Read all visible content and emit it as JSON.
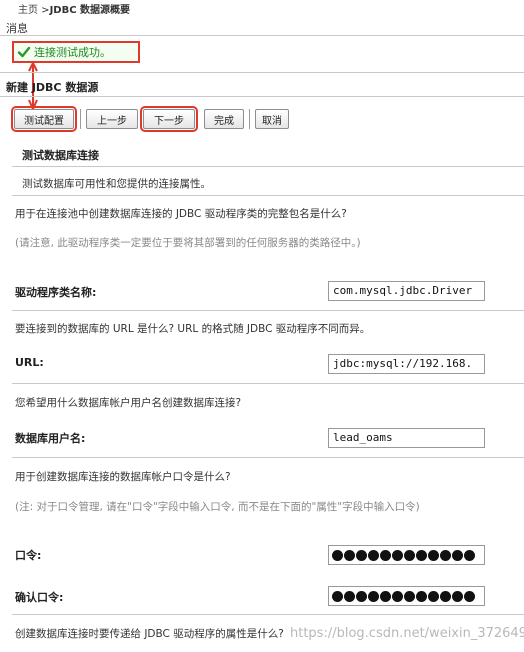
{
  "breadcrumb": {
    "home": "主页",
    "separator": " >",
    "current": "JDBC 数据源概要"
  },
  "message": {
    "section_title": "消息",
    "text": "连接测试成功。",
    "icon": "check-icon",
    "color": "#1d8a1d"
  },
  "form": {
    "title": "新建 JDBC 数据源",
    "toolbar": {
      "test_config": "测试配置",
      "prev": "上一步",
      "next": "下一步",
      "finish": "完成",
      "cancel": "取消"
    },
    "step_title": "测试数据库连接",
    "step_desc": "测试数据库可用性和您提供的连接属性。",
    "driver_question": "用于在连接池中创建数据库连接的 JDBC 驱动程序类的完整包名是什么?",
    "driver_note": "(请注意, 此驱动程序类一定要位于要将其部署到的任何服务器的类路径中。)",
    "driver_label": "驱动程序类名称:",
    "driver_value": "com.mysql.jdbc.Driver",
    "url_question": "要连接到的数据库的 URL 是什么? URL 的格式随 JDBC 驱动程序不同而异。",
    "url_label": "URL:",
    "url_value": "jdbc:mysql://192.168.",
    "user_question": "您希望用什么数据库帐户用户名创建数据库连接?",
    "user_label": "数据库用户名:",
    "user_value": "lead_oams",
    "password_question": "用于创建数据库连接的数据库帐户口令是什么?",
    "password_note": "(注: 对于口令管理, 请在\"口令\"字段中输入口令, 而不是在下面的\"属性\"字段中输入口令)",
    "password_label": "口令:",
    "confirm_label": "确认口令:",
    "props_question": "创建数据库连接时要传递给 JDBC 驱动程序的属性是什么?"
  },
  "watermark": "https://blog.csdn.net/weixin_37264997",
  "accent": "#e0382b"
}
